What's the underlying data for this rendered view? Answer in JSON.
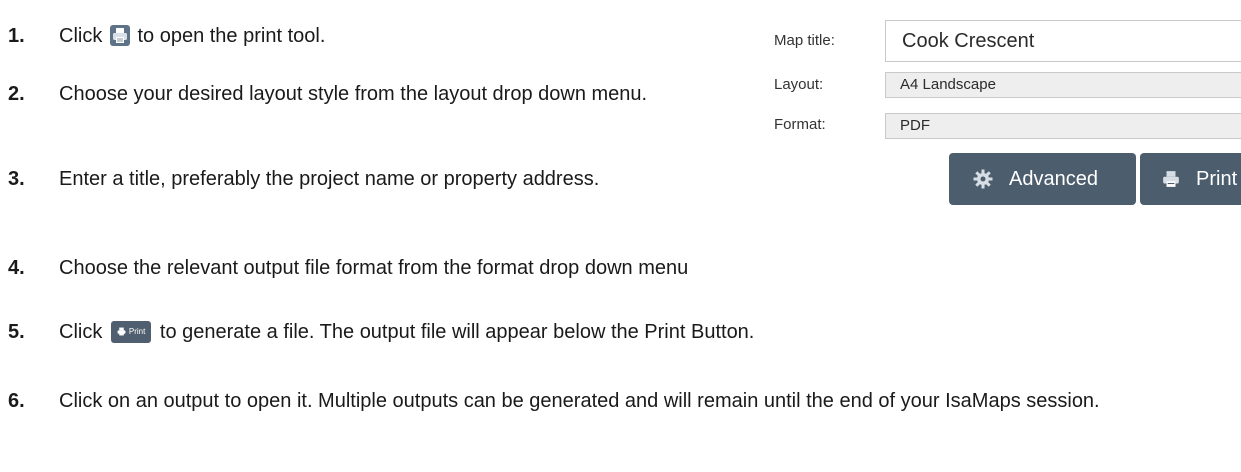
{
  "steps": [
    {
      "number": "1.",
      "before": "Click",
      "icon": "printer-icon",
      "after": "to open the print tool."
    },
    {
      "number": "2.",
      "text": "Choose your desired layout style from the layout drop down menu."
    },
    {
      "number": "3.",
      "text": "Enter a title, preferably the project name or property address."
    },
    {
      "number": "4.",
      "text": "Choose the relevant output file format from the format drop down menu"
    },
    {
      "number": "5.",
      "before": "Click",
      "inline_button_label": "Print",
      "after": "to generate a file. The output file will appear below the Print Button."
    },
    {
      "number": "6.",
      "text": "Click on an output to open it. Multiple outputs can be generated and will remain until the end of your IsaMaps session."
    }
  ],
  "print_panel": {
    "map_title_label": "Map title:",
    "map_title_value": "Cook Crescent",
    "layout_label": "Layout:",
    "layout_value": "A4 Landscape",
    "format_label": "Format:",
    "format_value": "PDF",
    "advanced_button": "Advanced",
    "print_button": "Print"
  },
  "colors": {
    "button_bg": "#4c5d6e",
    "select_bg": "#eeeeee",
    "icon_tile": "#5e7288"
  }
}
